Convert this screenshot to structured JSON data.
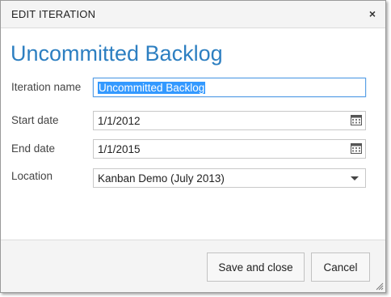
{
  "dialog": {
    "title": "EDIT ITERATION",
    "close_glyph": "×",
    "heading": "Uncommitted Backlog"
  },
  "form": {
    "iteration_name": {
      "label": "Iteration name",
      "value": "Uncommitted Backlog"
    },
    "start_date": {
      "label": "Start date",
      "value": "1/1/2012",
      "icon": "calendar-icon"
    },
    "end_date": {
      "label": "End date",
      "value": "1/1/2015",
      "icon": "calendar-icon"
    },
    "location": {
      "label": "Location",
      "value": "Kanban Demo (July 2013)",
      "icon": "chevron-down-icon"
    }
  },
  "footer": {
    "save_label": "Save and close",
    "cancel_label": "Cancel"
  },
  "colors": {
    "heading": "#2d7fc1",
    "selection": "#3399ff",
    "focus_border": "#5aa0e6"
  }
}
